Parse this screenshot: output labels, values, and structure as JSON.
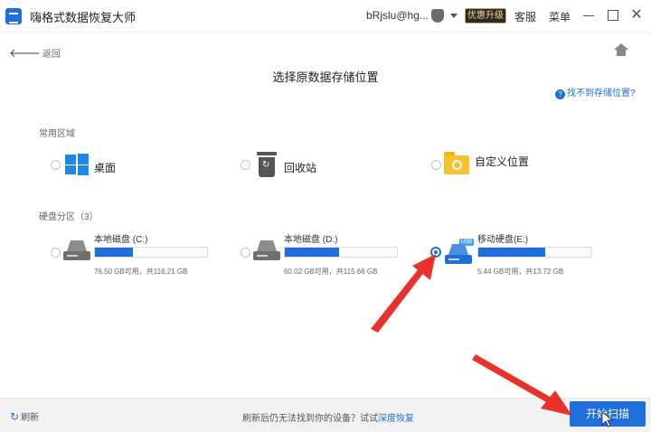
{
  "app": {
    "title": "嗨格式数据恢复大师",
    "account": "bRjslu@hg...",
    "upgrade_label": "优惠升级",
    "service_label": "客服",
    "menu_label": "菜单",
    "close_glyph": "✕"
  },
  "header": {
    "back_label": "返回",
    "back_glyph": "🡐",
    "title": "选择原数据存储位置",
    "help_link": "找不到存储位置?",
    "help_glyph": "?"
  },
  "common": {
    "label": "常用区域",
    "items": [
      {
        "label": "桌面",
        "icon": "windows-icon"
      },
      {
        "label": "回收站",
        "icon": "recycle-bin-icon"
      },
      {
        "label": "自定义位置",
        "icon": "folder-search-icon"
      }
    ]
  },
  "disks": {
    "label": "硬盘分区（3）",
    "items": [
      {
        "name": "本地磁盘 (C:)",
        "space": "76.50 GB可用，共116.21 GB",
        "used_fraction": 0.34,
        "selected": false
      },
      {
        "name": "本地磁盘 (D:)",
        "space": "60.02 GB可用，共115.66 GB",
        "used_fraction": 0.48,
        "selected": false
      },
      {
        "name": "移动硬盘(E:)",
        "space": "5.44 GB可用，共13.72 GB",
        "used_fraction": 0.6,
        "selected": true,
        "badge": "USB"
      }
    ]
  },
  "footer": {
    "refresh_label": "刷新",
    "refresh_glyph": "↻",
    "hint": "刷新后仍无法找到你的设备？试试",
    "deep_link": "深度恢复",
    "scan_button": "开始扫描"
  },
  "colors": {
    "accent": "#1e6fd9",
    "annotation": "#e8322b"
  }
}
